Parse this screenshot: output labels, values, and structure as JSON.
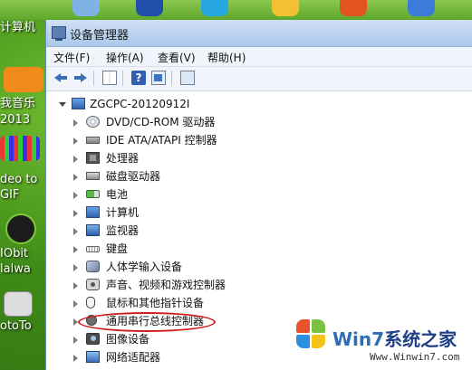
{
  "desktop": {
    "icons": [
      {
        "label": "计算机",
        "name": "desktop-computer-partial"
      },
      {
        "label": "我音乐",
        "name": "desktop-music-partial"
      },
      {
        "label": "2013",
        "name": "desktop-music-year"
      },
      {
        "label": "deo to",
        "name": "desktop-video-partial"
      },
      {
        "label": "GIF",
        "name": "desktop-gif-label"
      },
      {
        "label": "IObit",
        "name": "desktop-iobit-label"
      },
      {
        "label": "lalwa",
        "name": "desktop-malware-partial"
      },
      {
        "label": "otoTo",
        "name": "desktop-phototo-partial"
      }
    ]
  },
  "window": {
    "title": "设备管理器",
    "menu": [
      "文件(F)",
      "操作(A)",
      "查看(V)",
      "帮助(H)"
    ],
    "toolbar_icons": [
      "back-arrow-icon",
      "forward-arrow-icon",
      "properties-icon",
      "help-icon",
      "panel-icon",
      "scan-hardware-icon"
    ],
    "tree": {
      "root": "ZGCPC-20120912I",
      "nodes": [
        {
          "label": "DVD/CD-ROM 驱动器",
          "icon": "disc-icon"
        },
        {
          "label": "IDE ATA/ATAPI 控制器",
          "icon": "ide-controller-icon"
        },
        {
          "label": "处理器",
          "icon": "cpu-icon"
        },
        {
          "label": "磁盘驱动器",
          "icon": "hdd-icon"
        },
        {
          "label": "电池",
          "icon": "battery-icon"
        },
        {
          "label": "计算机",
          "icon": "computer-icon"
        },
        {
          "label": "监视器",
          "icon": "monitor-icon"
        },
        {
          "label": "键盘",
          "icon": "keyboard-icon"
        },
        {
          "label": "人体学输入设备",
          "icon": "hid-icon"
        },
        {
          "label": "声音、视频和游戏控制器",
          "icon": "audio-icon"
        },
        {
          "label": "鼠标和其他指针设备",
          "icon": "mouse-icon"
        },
        {
          "label": "通用串行总线控制器",
          "icon": "usb-icon"
        },
        {
          "label": "图像设备",
          "icon": "camera-icon"
        },
        {
          "label": "网络适配器",
          "icon": "network-icon"
        }
      ]
    }
  },
  "watermark": {
    "brand_win": "Win",
    "brand_7": "7",
    "brand_cn": "系统之家",
    "url": "Www.Winwin7.com"
  },
  "colors": {
    "highlight": "#d11a1a",
    "desktop_green": "#4f9a1e",
    "titlebar": "#bcd4f0"
  }
}
